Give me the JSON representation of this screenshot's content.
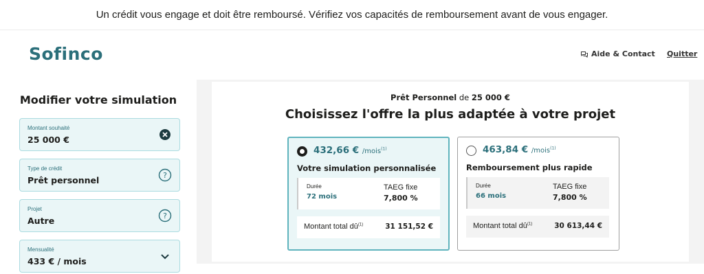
{
  "disclaimer": "Un crédit vous engage et doit être remboursé. Vérifiez vos capacités de remboursement avant de vous engager.",
  "header": {
    "logo": "Sofinco",
    "help_label": "Aide & Contact",
    "quit_label": "Quitter"
  },
  "sidebar": {
    "title": "Modifier votre simulation",
    "fields": [
      {
        "label": "Montant souhaité",
        "value": "25 000  €",
        "icon": "clear-icon"
      },
      {
        "label": "Type de crédit",
        "value": "Prêt personnel",
        "icon": "help-icon"
      },
      {
        "label": "Projet",
        "value": "Autre",
        "icon": "help-icon"
      },
      {
        "label": "Mensualité",
        "value": "433 € / mois",
        "icon": "chevron-down-icon"
      }
    ]
  },
  "main": {
    "subtitle_product": "Prêt Personnel",
    "subtitle_de": " de ",
    "subtitle_amount": "25 000 €",
    "headline": "Choisissez l'offre la plus adaptée à votre projet",
    "offers": [
      {
        "price": "432,66 €",
        "unit": "/mois",
        "note": "(1)",
        "title": "Votre simulation personnalisée",
        "duration_label": "Durée",
        "duration_value": "72 mois",
        "taeg_label": "TAEG fixe",
        "taeg_value": "7,800 %",
        "total_label": "Montant total dû",
        "total_note": "(1)",
        "total_value": "31 151,52 €",
        "selected": true
      },
      {
        "price": "463,84 €",
        "unit": "/mois",
        "note": "(1)",
        "title": "Remboursement plus rapide",
        "duration_label": "Durée",
        "duration_value": "66 mois",
        "taeg_label": "TAEG fixe",
        "taeg_value": "7,800 %",
        "total_label": "Montant total dû",
        "total_note": "(1)",
        "total_value": "30 613,44 €",
        "selected": false
      }
    ]
  },
  "colors": {
    "brand": "#2b6f7a",
    "field_bg": "#eaf6f7",
    "field_border": "#aadbe0",
    "selected_border": "#5fb3bd"
  }
}
